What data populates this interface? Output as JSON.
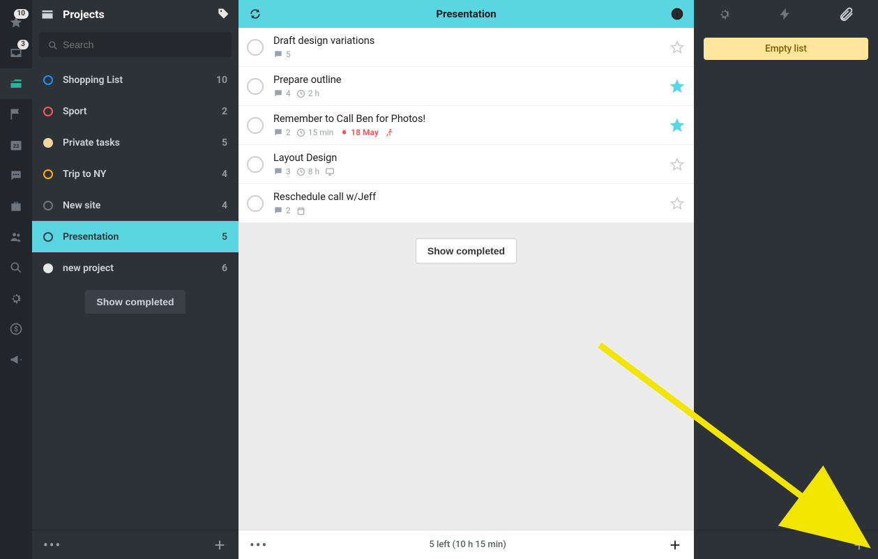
{
  "rail": {
    "icons": [
      {
        "name": "star-icon",
        "badge": "10"
      },
      {
        "name": "inbox-icon",
        "badge": "3"
      },
      {
        "name": "archive-icon",
        "active": true
      },
      {
        "name": "flag-icon"
      },
      {
        "name": "calendar-icon",
        "day": "23"
      },
      {
        "name": "chat-icon"
      },
      {
        "name": "briefcase-icon"
      },
      {
        "name": "people-icon"
      },
      {
        "name": "search-icon"
      },
      {
        "name": "gear-icon"
      },
      {
        "name": "dollar-icon"
      },
      {
        "name": "megaphone-icon"
      }
    ]
  },
  "sidebar": {
    "title": "Projects",
    "search_placeholder": "Search",
    "show_completed_label": "Show completed",
    "projects": [
      {
        "name": "Shopping List",
        "count": "10",
        "color": "#1e90ff",
        "ring": true
      },
      {
        "name": "Sport",
        "count": "2",
        "color": "#ff5a5a",
        "ring": true
      },
      {
        "name": "Private tasks",
        "count": "5",
        "color": "#f2d59f",
        "solid": true
      },
      {
        "name": "Trip to NY",
        "count": "4",
        "color": "#ffb300",
        "ring": true
      },
      {
        "name": "New site",
        "count": "4",
        "color": "#6e757c",
        "ring": true
      },
      {
        "name": "Presentation",
        "count": "5",
        "color": "#3a4046",
        "ring": true,
        "active": true
      },
      {
        "name": "new project",
        "count": "6",
        "color": "#e8e8e8",
        "solid": true
      }
    ]
  },
  "main": {
    "title": "Presentation",
    "show_completed_label": "Show completed",
    "status": "5 left (10 h 15 min)",
    "tasks": [
      {
        "name": "Draft design variations",
        "comments": "5",
        "starred": false
      },
      {
        "name": "Prepare outline",
        "comments": "4",
        "time": "2 h",
        "starred": true
      },
      {
        "name": "Remember to Call Ben for Photos!",
        "comments": "2",
        "time": "15 min",
        "due": "18 May",
        "overdue": true,
        "run": true,
        "starred": true
      },
      {
        "name": "Layout Design",
        "comments": "3",
        "time": "8 h",
        "screen": true,
        "starred": false
      },
      {
        "name": "Reschedule call w/Jeff",
        "comments": "2",
        "cal": true,
        "starred": false
      }
    ]
  },
  "right": {
    "empty_label": "Empty list"
  }
}
